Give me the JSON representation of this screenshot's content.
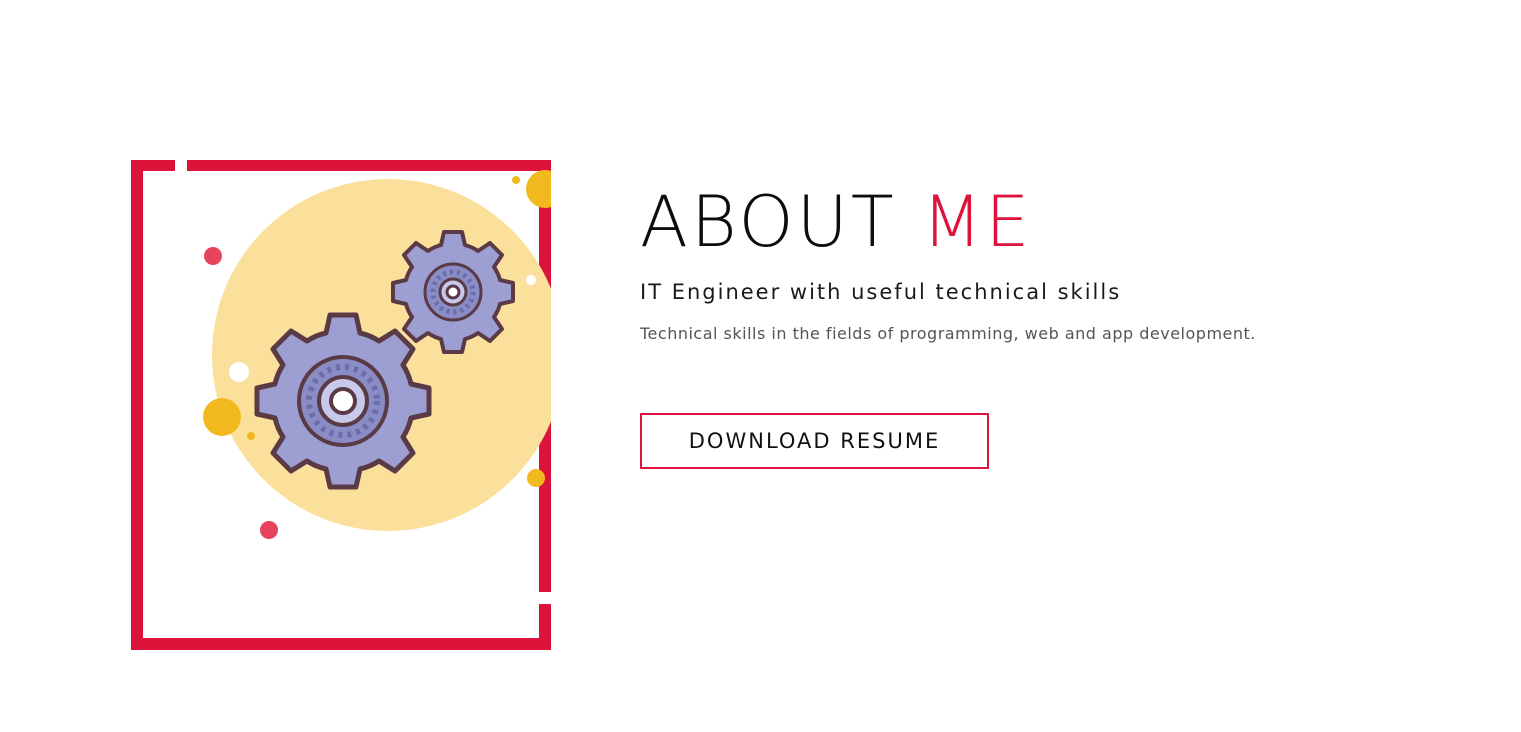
{
  "about": {
    "heading_main": "ABOUT",
    "heading_accent": "ME",
    "subtitle": "IT Engineer with useful technical skills",
    "description": "Technical skills in the fields of programming, web and app development.",
    "download_button_label": "DOWNLOAD RESUME"
  },
  "illustration": {
    "icon": "gears-icon"
  },
  "colors": {
    "accent": "#dc143c",
    "circle": "#fbe09c",
    "gear": "#9d9fd3",
    "gear_outline": "#5a3a45",
    "yellow_dot": "#f2b91f",
    "red_dot": "#e8435c",
    "text": "#0d0d0d"
  }
}
